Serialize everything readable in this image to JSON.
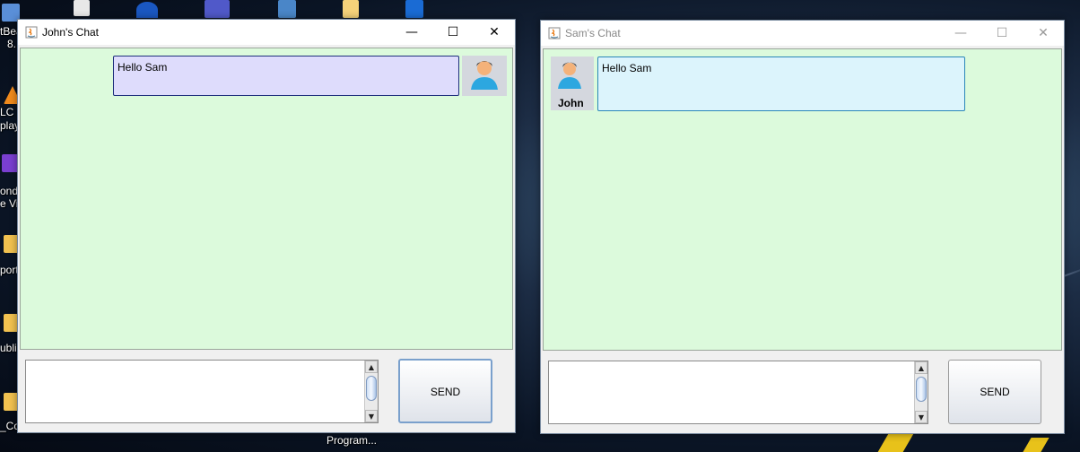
{
  "desktop": {
    "icons": [
      {
        "name": "netbeans-icon",
        "label_lines": [
          "tBea",
          "8."
        ]
      },
      {
        "name": "vlc-icon",
        "label_lines": [
          "LC m",
          "play"
        ]
      },
      {
        "name": "wondershare-icon",
        "label_lines": [
          "onde",
          "e Vi"
        ]
      },
      {
        "name": "folder-icon",
        "label_lines": [
          "port"
        ]
      },
      {
        "name": "folder-icon-2",
        "label_lines": [
          "ubli"
        ]
      },
      {
        "name": "folder-icon-3",
        "label_lines": [
          "_Co"
        ]
      }
    ],
    "bottom_labels": [
      "Program..."
    ]
  },
  "john_window": {
    "title": "John's Chat",
    "controls": {
      "minimize": "—",
      "maximize": "☐",
      "close": "✕"
    },
    "message": {
      "text": "Hello Sam"
    },
    "send_label": "SEND",
    "input_value": ""
  },
  "sam_window": {
    "title": "Sam's Chat",
    "controls": {
      "minimize": "—",
      "maximize": "☐",
      "close": "✕"
    },
    "message": {
      "text": "Hello Sam",
      "sender": "John"
    },
    "send_label": "SEND",
    "input_value": ""
  },
  "colors": {
    "chat_bg": "#dcfadc",
    "sent_bubble": "#dedcfc",
    "received_bubble": "#dcf4fc",
    "accent": "#1e4f9c"
  }
}
